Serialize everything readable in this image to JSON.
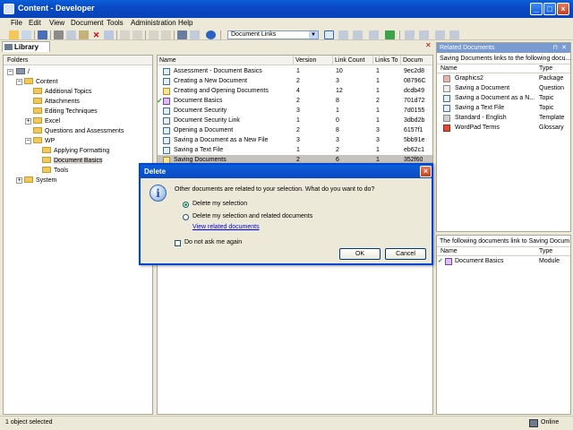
{
  "window": {
    "title": "Content - Developer"
  },
  "menu": [
    "File",
    "Edit",
    "View",
    "Document",
    "Tools",
    "Administration",
    "Help"
  ],
  "toolbar": {
    "combo_value": "Document Links"
  },
  "library_tab": {
    "label": "Library"
  },
  "folders": {
    "header": "Folders",
    "nodes": [
      {
        "label": "/",
        "depth": 0
      },
      {
        "label": "Content",
        "depth": 1
      },
      {
        "label": "Additional Topics",
        "depth": 2
      },
      {
        "label": "Attachments",
        "depth": 2
      },
      {
        "label": "Editing Techniques",
        "depth": 2
      },
      {
        "label": "Excel",
        "depth": 2
      },
      {
        "label": "Questions and Assessments",
        "depth": 2
      },
      {
        "label": "WP",
        "depth": 2
      },
      {
        "label": "Applying Formatting",
        "depth": 3
      },
      {
        "label": "Document Basics",
        "depth": 3
      },
      {
        "label": "Tools",
        "depth": 3
      },
      {
        "label": "System",
        "depth": 1
      }
    ]
  },
  "documents": {
    "columns": [
      "Name",
      "Version",
      "Link Count",
      "Links To",
      "Docum"
    ],
    "rows": [
      {
        "name": "Assessment - Document Basics",
        "version": "1",
        "link_count": "10",
        "links_to": "1",
        "doc": "9ec2d8"
      },
      {
        "name": "Creating a New Document",
        "version": "2",
        "link_count": "3",
        "links_to": "1",
        "doc": "08796C"
      },
      {
        "name": "Creating and Opening Documents",
        "version": "4",
        "link_count": "12",
        "links_to": "1",
        "doc": "dcdb49"
      },
      {
        "name": "Document Basics",
        "version": "2",
        "link_count": "8",
        "links_to": "2",
        "doc": "701d72"
      },
      {
        "name": "Document Security",
        "version": "3",
        "link_count": "1",
        "links_to": "1",
        "doc": "7d0155"
      },
      {
        "name": "Document Security Link",
        "version": "1",
        "link_count": "0",
        "links_to": "1",
        "doc": "3dbd2b"
      },
      {
        "name": "Opening a Document",
        "version": "2",
        "link_count": "8",
        "links_to": "3",
        "doc": "6157f1"
      },
      {
        "name": "Saving a Document as a New File",
        "version": "3",
        "link_count": "3",
        "links_to": "3",
        "doc": "5bb91e"
      },
      {
        "name": "Saving a Text File",
        "version": "1",
        "link_count": "2",
        "links_to": "1",
        "doc": "eb62c1"
      },
      {
        "name": "Saving Documents",
        "version": "2",
        "link_count": "6",
        "links_to": "1",
        "doc": "352f60"
      }
    ]
  },
  "related": {
    "title": "Related Documents",
    "description": "Saving Documents links to the following docu...",
    "columns": [
      "Name",
      "Type"
    ],
    "rows": [
      {
        "name": "Graphics2",
        "type": "Package"
      },
      {
        "name": "Saving a Document",
        "type": "Question"
      },
      {
        "name": "Saving a Document as a N...",
        "type": "Topic"
      },
      {
        "name": "Saving a Text File",
        "type": "Topic"
      },
      {
        "name": "Standard - English",
        "type": "Template"
      },
      {
        "name": "WordPad Terms",
        "type": "Glossary"
      }
    ]
  },
  "backlinks": {
    "description": "The following documents link to Saving Docum...",
    "columns": [
      "Name",
      "Type"
    ],
    "rows": [
      {
        "name": "Document Basics",
        "type": "Module"
      }
    ]
  },
  "status": {
    "left": "1 object selected",
    "right": "Online"
  },
  "dialog": {
    "title": "Delete",
    "message": "Other documents are related to your selection. What do you want to do?",
    "option1": "Delete my selection",
    "option2": "Delete my selection and related documents",
    "link": "View related documents",
    "checkbox": "Do not ask me again",
    "ok": "OK",
    "cancel": "Cancel"
  }
}
